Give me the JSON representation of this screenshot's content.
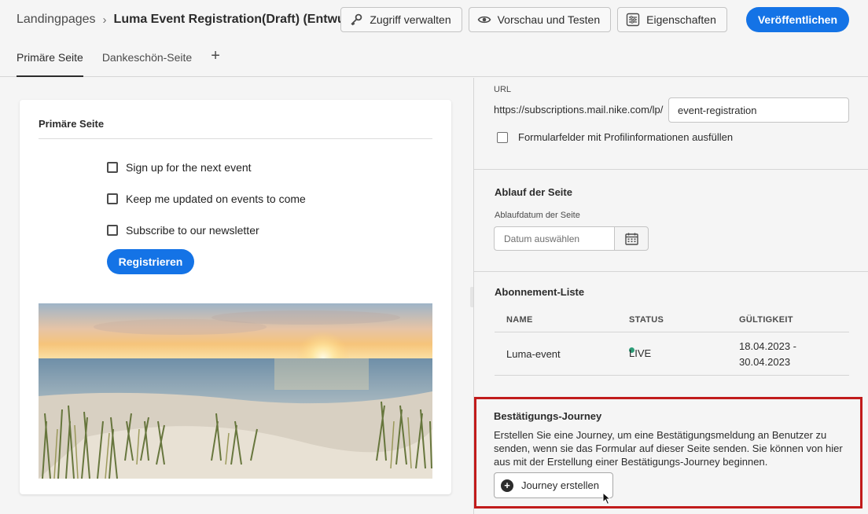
{
  "breadcrumb": {
    "root": "Landingpages",
    "separator": "›",
    "title": "Luma Event Registration(Draft) (Entwurf)"
  },
  "toolbar": {
    "access_label": "Zugriff verwalten",
    "preview_label": "Vorschau und Testen",
    "properties_label": "Eigenschaften",
    "publish_label": "Veröffentlichen"
  },
  "tabs": [
    {
      "label": "Primäre Seite",
      "active": true
    },
    {
      "label": "Dankeschön-Seite",
      "active": false
    }
  ],
  "add_tab_label": "+",
  "canvas": {
    "card_title": "Primäre Seite",
    "checkboxes": [
      "Sign up for the next event",
      "Keep me updated on events to come",
      "Subscribe to our newsletter"
    ],
    "register_label": "Registrieren"
  },
  "panel": {
    "url_label": "URL",
    "url_prefix": "https://subscriptions.mail.nike.com/lp/",
    "url_slug": "event-registration",
    "prefill_label": "Formularfelder mit Profilinformationen ausfüllen",
    "expiry": {
      "title": "Ablauf der Seite",
      "date_label": "Ablaufdatum der Seite",
      "date_placeholder": "Datum auswählen"
    },
    "subscription": {
      "title": "Abonnement-Liste",
      "columns": [
        "NAME",
        "STATUS",
        "GÜLTIGKEIT"
      ],
      "row": {
        "name": "Luma-event",
        "status": "LIVE",
        "validity_from": "18.04.2023 -",
        "validity_to": "30.04.2023"
      }
    },
    "journey": {
      "title": "Bestätigungs-Journey",
      "description": "Erstellen Sie eine Journey, um eine Bestätigungsmeldung an Benutzer zu senden, wenn sie das Formular auf dieser Seite senden. Sie können von hier aus mit der Erstellung einer Bestätigungs-Journey beginnen.",
      "button_label": "Journey erstellen"
    }
  },
  "colors": {
    "accent": "#1473e6",
    "live": "#2d9d78",
    "highlight": "#c11b1b"
  }
}
